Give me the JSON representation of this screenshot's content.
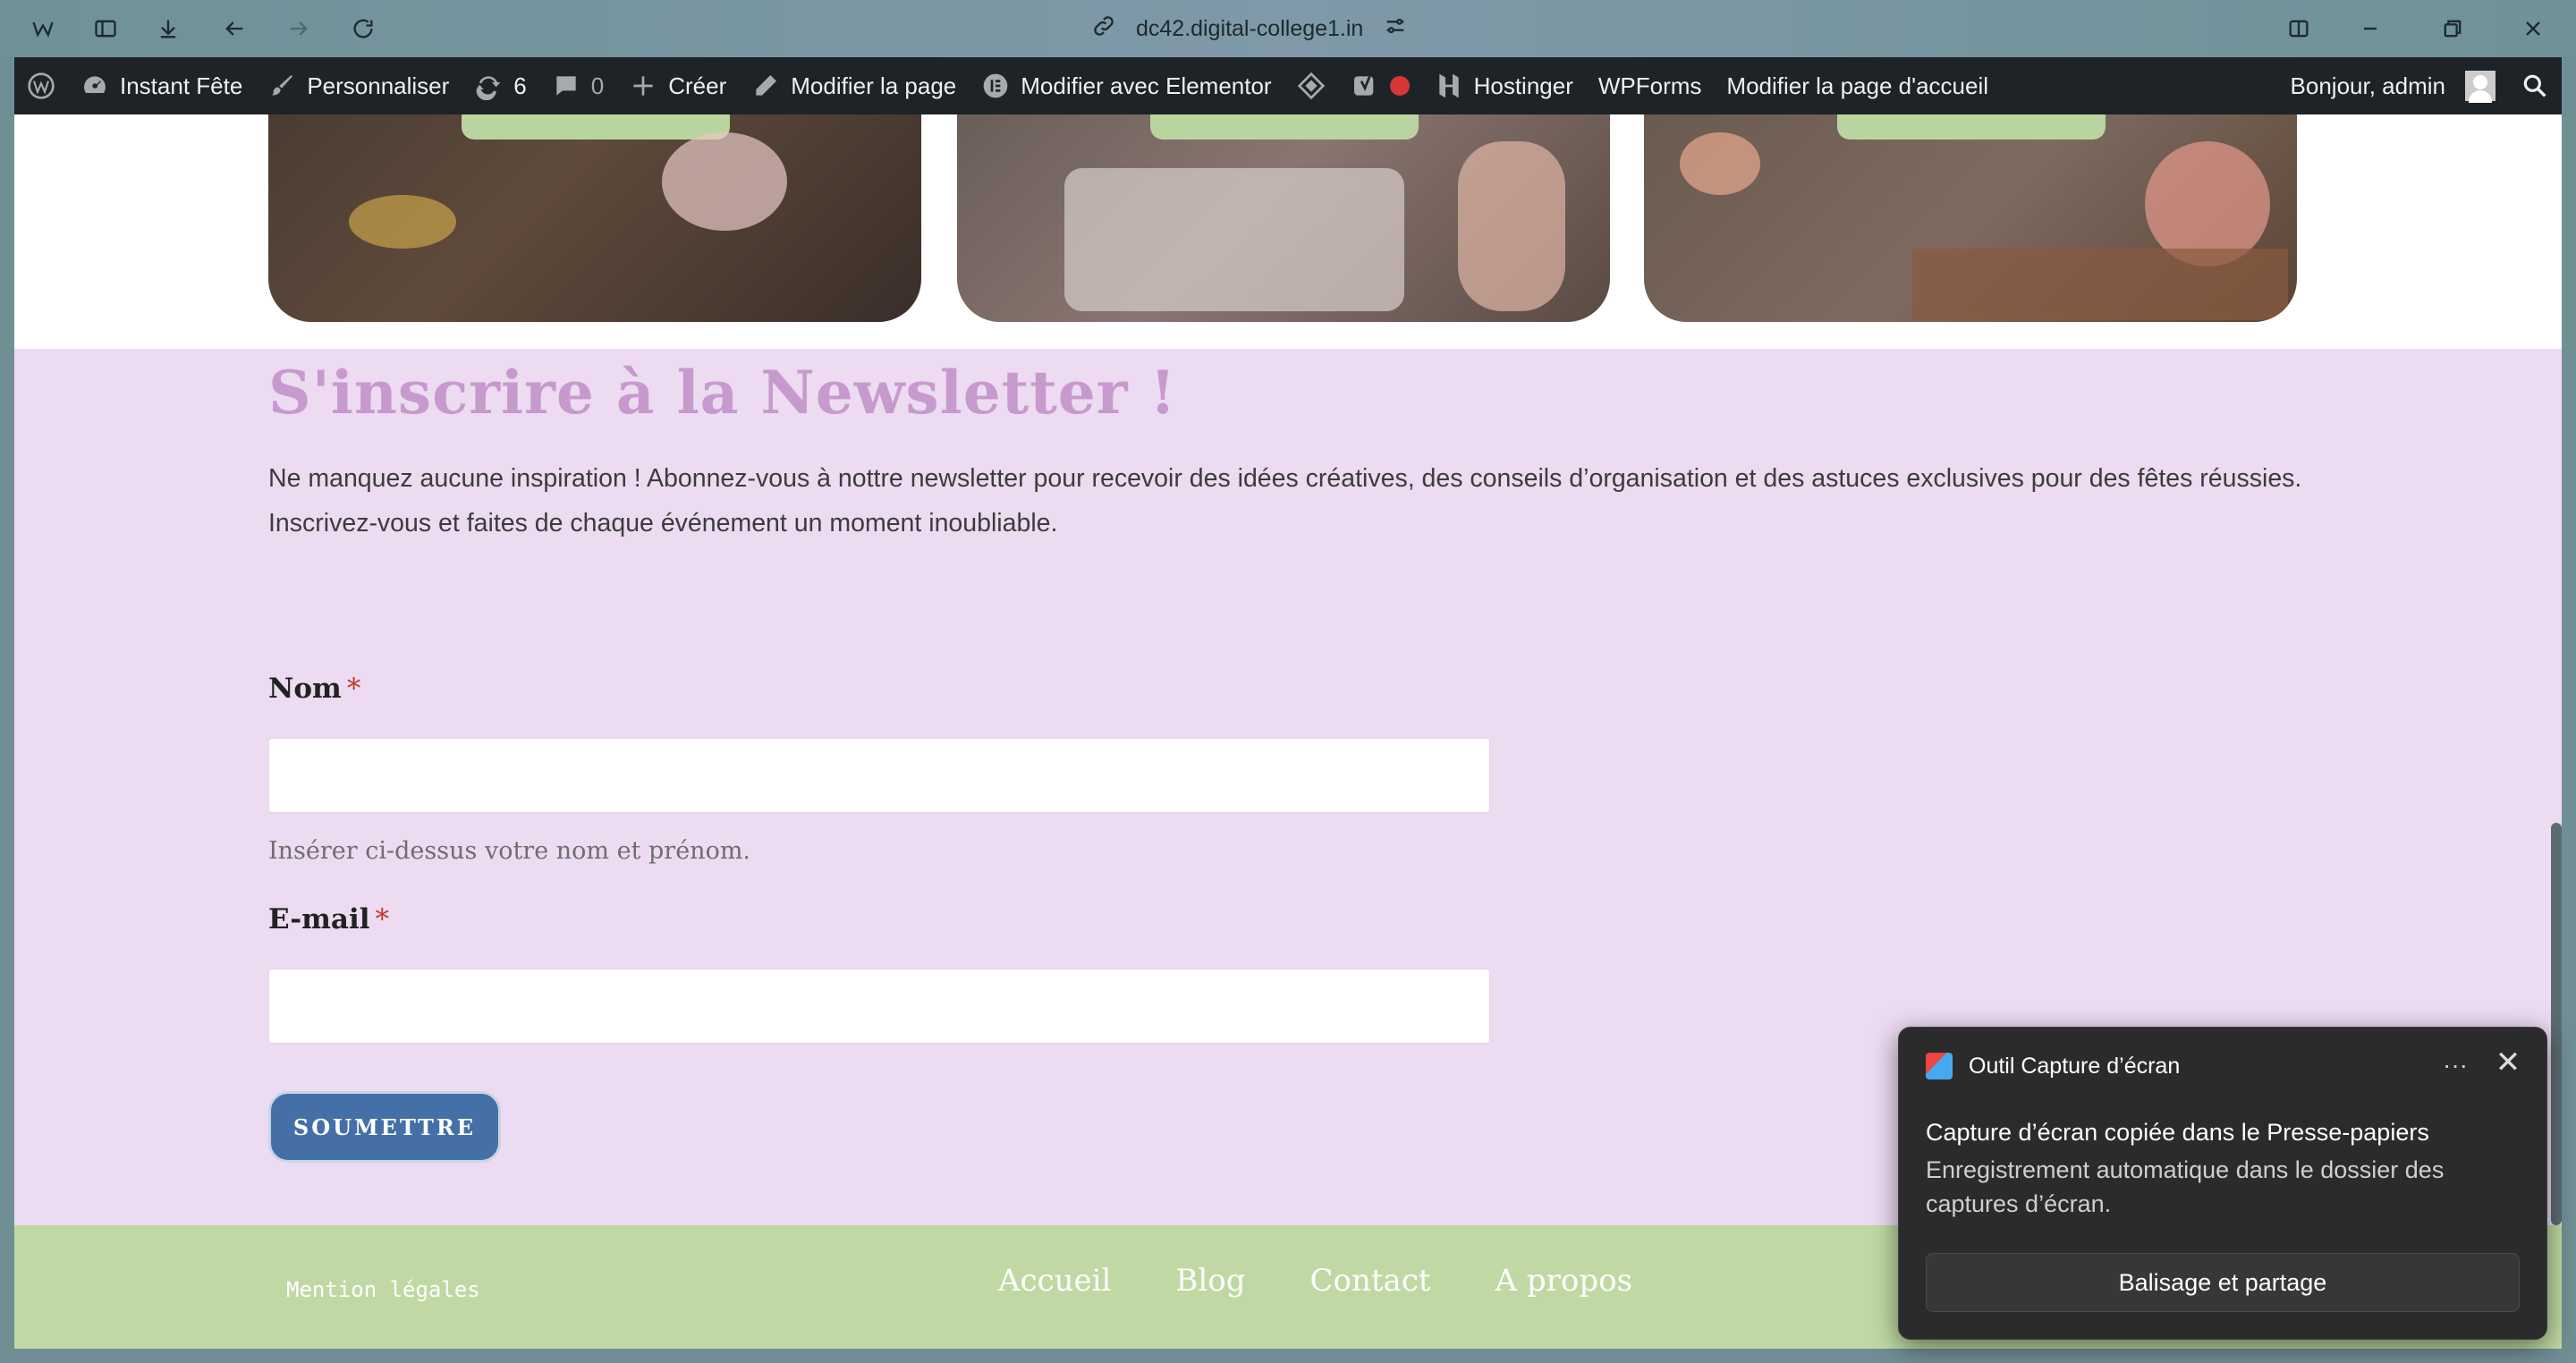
{
  "browser": {
    "url": "dc42.digital-college1.in"
  },
  "adminbar": {
    "site_name": "Instant Fête",
    "customize": "Personnaliser",
    "updates_count": "6",
    "comments_count": "0",
    "new": "Créer",
    "edit_page": "Modifier la page",
    "edit_elementor": "Modifier avec Elementor",
    "hostinger": "Hostinger",
    "wpforms": "WPForms",
    "edit_home": "Modifier la page d'accueil",
    "greeting": "Bonjour, admin"
  },
  "newsletter": {
    "title": "S'inscrire à la Newsletter !",
    "text_line1": "Ne manquez aucune inspiration ! Abonnez-vous à nottre newsletter pour recevoir des idées créatives, des conseils d’organisation et des astuces exclusives pour des fêtes réussies.",
    "text_line2": "Inscrivez-vous et faites de chaque événement un moment inoubliable.",
    "name_label": "Nom",
    "name_hint": "Insérer ci-dessus votre nom et prénom.",
    "email_label": "E-mail",
    "required_mark": "*",
    "submit_label": "SOUMETTRE"
  },
  "footer": {
    "mention": "Mention légales",
    "nav": [
      "Accueil",
      "Blog",
      "Contact",
      "A propos"
    ]
  },
  "toast": {
    "app_name": "Outil Capture d’écran",
    "more": "···",
    "close": "✕",
    "title": "Capture d’écran copiée dans le Presse-papiers",
    "body": "Enregistrement automatique dans le dossier des captures d’écran.",
    "button": "Balisage et partage"
  }
}
